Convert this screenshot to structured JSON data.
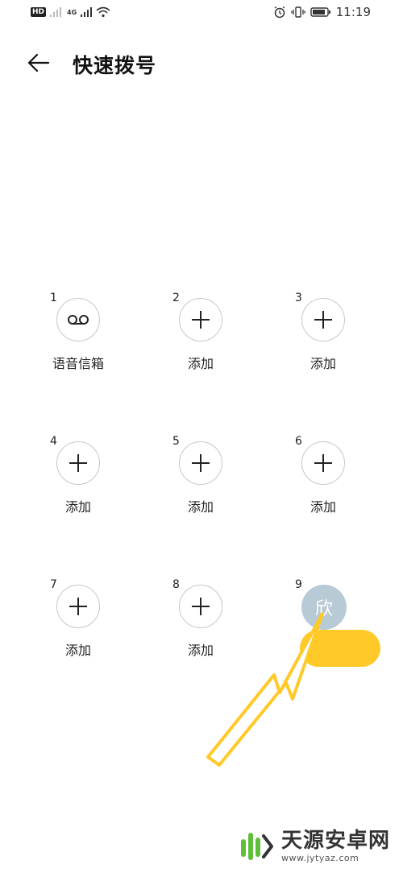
{
  "status_bar": {
    "hd": "HD",
    "network": "4G",
    "time": "11:19"
  },
  "header": {
    "title": "快速拨号"
  },
  "cells": [
    {
      "number": "1",
      "label": "语音信箱",
      "icon": "voicemail-icon"
    },
    {
      "number": "2",
      "label": "添加",
      "icon": "plus-icon"
    },
    {
      "number": "3",
      "label": "添加",
      "icon": "plus-icon"
    },
    {
      "number": "4",
      "label": "添加",
      "icon": "plus-icon"
    },
    {
      "number": "5",
      "label": "添加",
      "icon": "plus-icon"
    },
    {
      "number": "6",
      "label": "添加",
      "icon": "plus-icon"
    },
    {
      "number": "7",
      "label": "添加",
      "icon": "plus-icon"
    },
    {
      "number": "8",
      "label": "添加",
      "icon": "plus-icon"
    },
    {
      "number": "9",
      "avatar_text": "欣",
      "icon": "contact-avatar"
    }
  ],
  "watermark": {
    "name": "天源安卓网",
    "url": "www.jytyaz.com"
  },
  "colors": {
    "annotation": "#ffc928",
    "avatar_bg": "#b8cad6",
    "watermark_green": "#5fbf3a"
  }
}
